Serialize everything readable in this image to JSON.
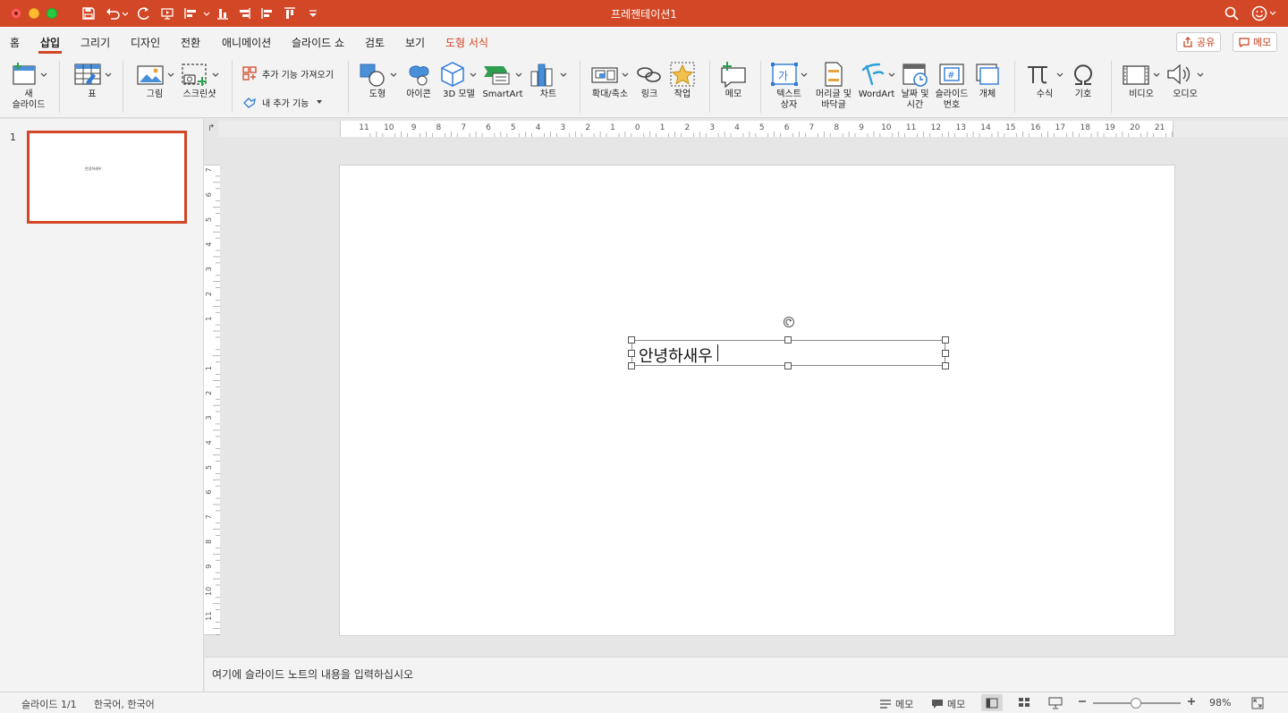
{
  "window": {
    "title": "프레젠테이션1"
  },
  "tabs": [
    {
      "label": "홈"
    },
    {
      "label": "삽입"
    },
    {
      "label": "그리기"
    },
    {
      "label": "디자인"
    },
    {
      "label": "전환"
    },
    {
      "label": "애니메이션"
    },
    {
      "label": "슬라이드 쇼"
    },
    {
      "label": "검토"
    },
    {
      "label": "보기"
    },
    {
      "label": "도형 서식"
    }
  ],
  "active_tab": "삽입",
  "contextual_tab": "도형 서식",
  "header_buttons": {
    "share": "공유",
    "comments": "메모"
  },
  "ribbon": {
    "new_slide": "새\n슬라이드",
    "new_slide_line1": "새",
    "new_slide_line2": "슬라이드",
    "table": "표",
    "picture": "그림",
    "screenshot": "스크린샷",
    "get_addins": "추가 기능 가져오기",
    "my_addins": "내 추가 기능",
    "shapes": "도형",
    "icons": "아이콘",
    "models_3d": "3D 모델",
    "smartart": "SmartArt",
    "chart": "차트",
    "zoom": "확대/축소",
    "link": "링크",
    "action": "작업",
    "comment": "메모",
    "textbox_line1": "텍스트",
    "textbox_line2": "상자",
    "header_footer_line1": "머리글 및",
    "header_footer_line2": "바닥글",
    "wordart": "WordArt",
    "datetime_line1": "날짜 및",
    "datetime_line2": "시간",
    "slide_number_line1": "슬라이드",
    "slide_number_line2": "번호",
    "object": "개체",
    "equation": "수식",
    "symbol": "기호",
    "video": "비디오",
    "audio": "오디오"
  },
  "slides_panel": {
    "slide_number": "1",
    "thumb_text": "안녕하새우"
  },
  "ruler": {
    "horizontal": [
      "11",
      "10",
      "9",
      "8",
      "7",
      "6",
      "5",
      "4",
      "3",
      "2",
      "1",
      "0",
      "1",
      "2",
      "3",
      "4",
      "5",
      "6",
      "7",
      "8",
      "9",
      "10",
      "11",
      "12",
      "13",
      "14",
      "15",
      "16",
      "17",
      "18",
      "19",
      "20",
      "21"
    ],
    "vertical": [
      "7",
      "6",
      "5",
      "4",
      "3",
      "2",
      "1",
      "",
      "1",
      "2",
      "3",
      "4",
      "5",
      "6",
      "7",
      "8",
      "9",
      "10",
      "11"
    ]
  },
  "slide": {
    "textbox_text": "안녕하새우"
  },
  "notes": {
    "placeholder": "여기에 슬라이드 노트의 내용을 입력하십시오"
  },
  "status": {
    "slide_indicator": "슬라이드 1/1",
    "language": "한국어, 한국어",
    "notes_button": "메모",
    "comments_button": "메모",
    "zoom": "98%"
  },
  "colors": {
    "accent": "#d24726"
  }
}
